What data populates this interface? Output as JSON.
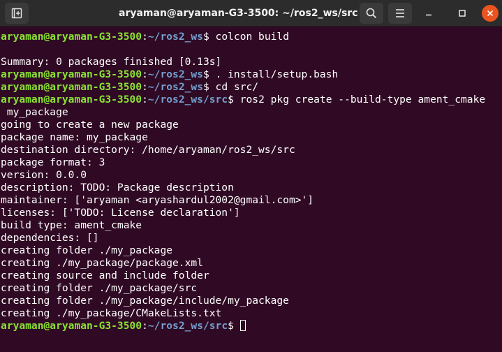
{
  "window": {
    "title": "aryaman@aryaman-G3-3500: ~/ros2_ws/src",
    "icons": {
      "new_tab": "new-tab-icon",
      "search": "search-icon",
      "menu": "hamburger-menu-icon",
      "minimize": "minimize-icon",
      "maximize": "maximize-icon",
      "close": "close-icon"
    }
  },
  "colors": {
    "background": "#300a24",
    "prompt_user": "#8ae234",
    "prompt_path": "#729fcf",
    "text": "#ffffff",
    "close_button": "#e95420"
  },
  "terminal": {
    "prompt_user": "aryaman@aryaman-G3-3500",
    "lines": [
      {
        "type": "prompt",
        "path": "~/ros2_ws",
        "cmd": " colcon build"
      },
      {
        "type": "output",
        "text": ""
      },
      {
        "type": "output",
        "text": "Summary: 0 packages finished [0.13s]"
      },
      {
        "type": "prompt",
        "path": "~/ros2_ws",
        "cmd": " . install/setup.bash"
      },
      {
        "type": "prompt",
        "path": "~/ros2_ws",
        "cmd": " cd src/"
      },
      {
        "type": "prompt",
        "path": "~/ros2_ws/src",
        "cmd": " ros2 pkg create --build-type ament_cmake"
      },
      {
        "type": "output",
        "text": " my_package"
      },
      {
        "type": "output",
        "text": "going to create a new package"
      },
      {
        "type": "output",
        "text": "package name: my_package"
      },
      {
        "type": "output",
        "text": "destination directory: /home/aryaman/ros2_ws/src"
      },
      {
        "type": "output",
        "text": "package format: 3"
      },
      {
        "type": "output",
        "text": "version: 0.0.0"
      },
      {
        "type": "output",
        "text": "description: TODO: Package description"
      },
      {
        "type": "output",
        "text": "maintainer: ['aryaman <aryashardul2002@gmail.com>']"
      },
      {
        "type": "output",
        "text": "licenses: ['TODO: License declaration']"
      },
      {
        "type": "output",
        "text": "build type: ament_cmake"
      },
      {
        "type": "output",
        "text": "dependencies: []"
      },
      {
        "type": "output",
        "text": "creating folder ./my_package"
      },
      {
        "type": "output",
        "text": "creating ./my_package/package.xml"
      },
      {
        "type": "output",
        "text": "creating source and include folder"
      },
      {
        "type": "output",
        "text": "creating folder ./my_package/src"
      },
      {
        "type": "output",
        "text": "creating folder ./my_package/include/my_package"
      },
      {
        "type": "output",
        "text": "creating ./my_package/CMakeLists.txt"
      },
      {
        "type": "prompt",
        "path": "~/ros2_ws/src",
        "cmd": " ",
        "cursor": true
      }
    ]
  }
}
